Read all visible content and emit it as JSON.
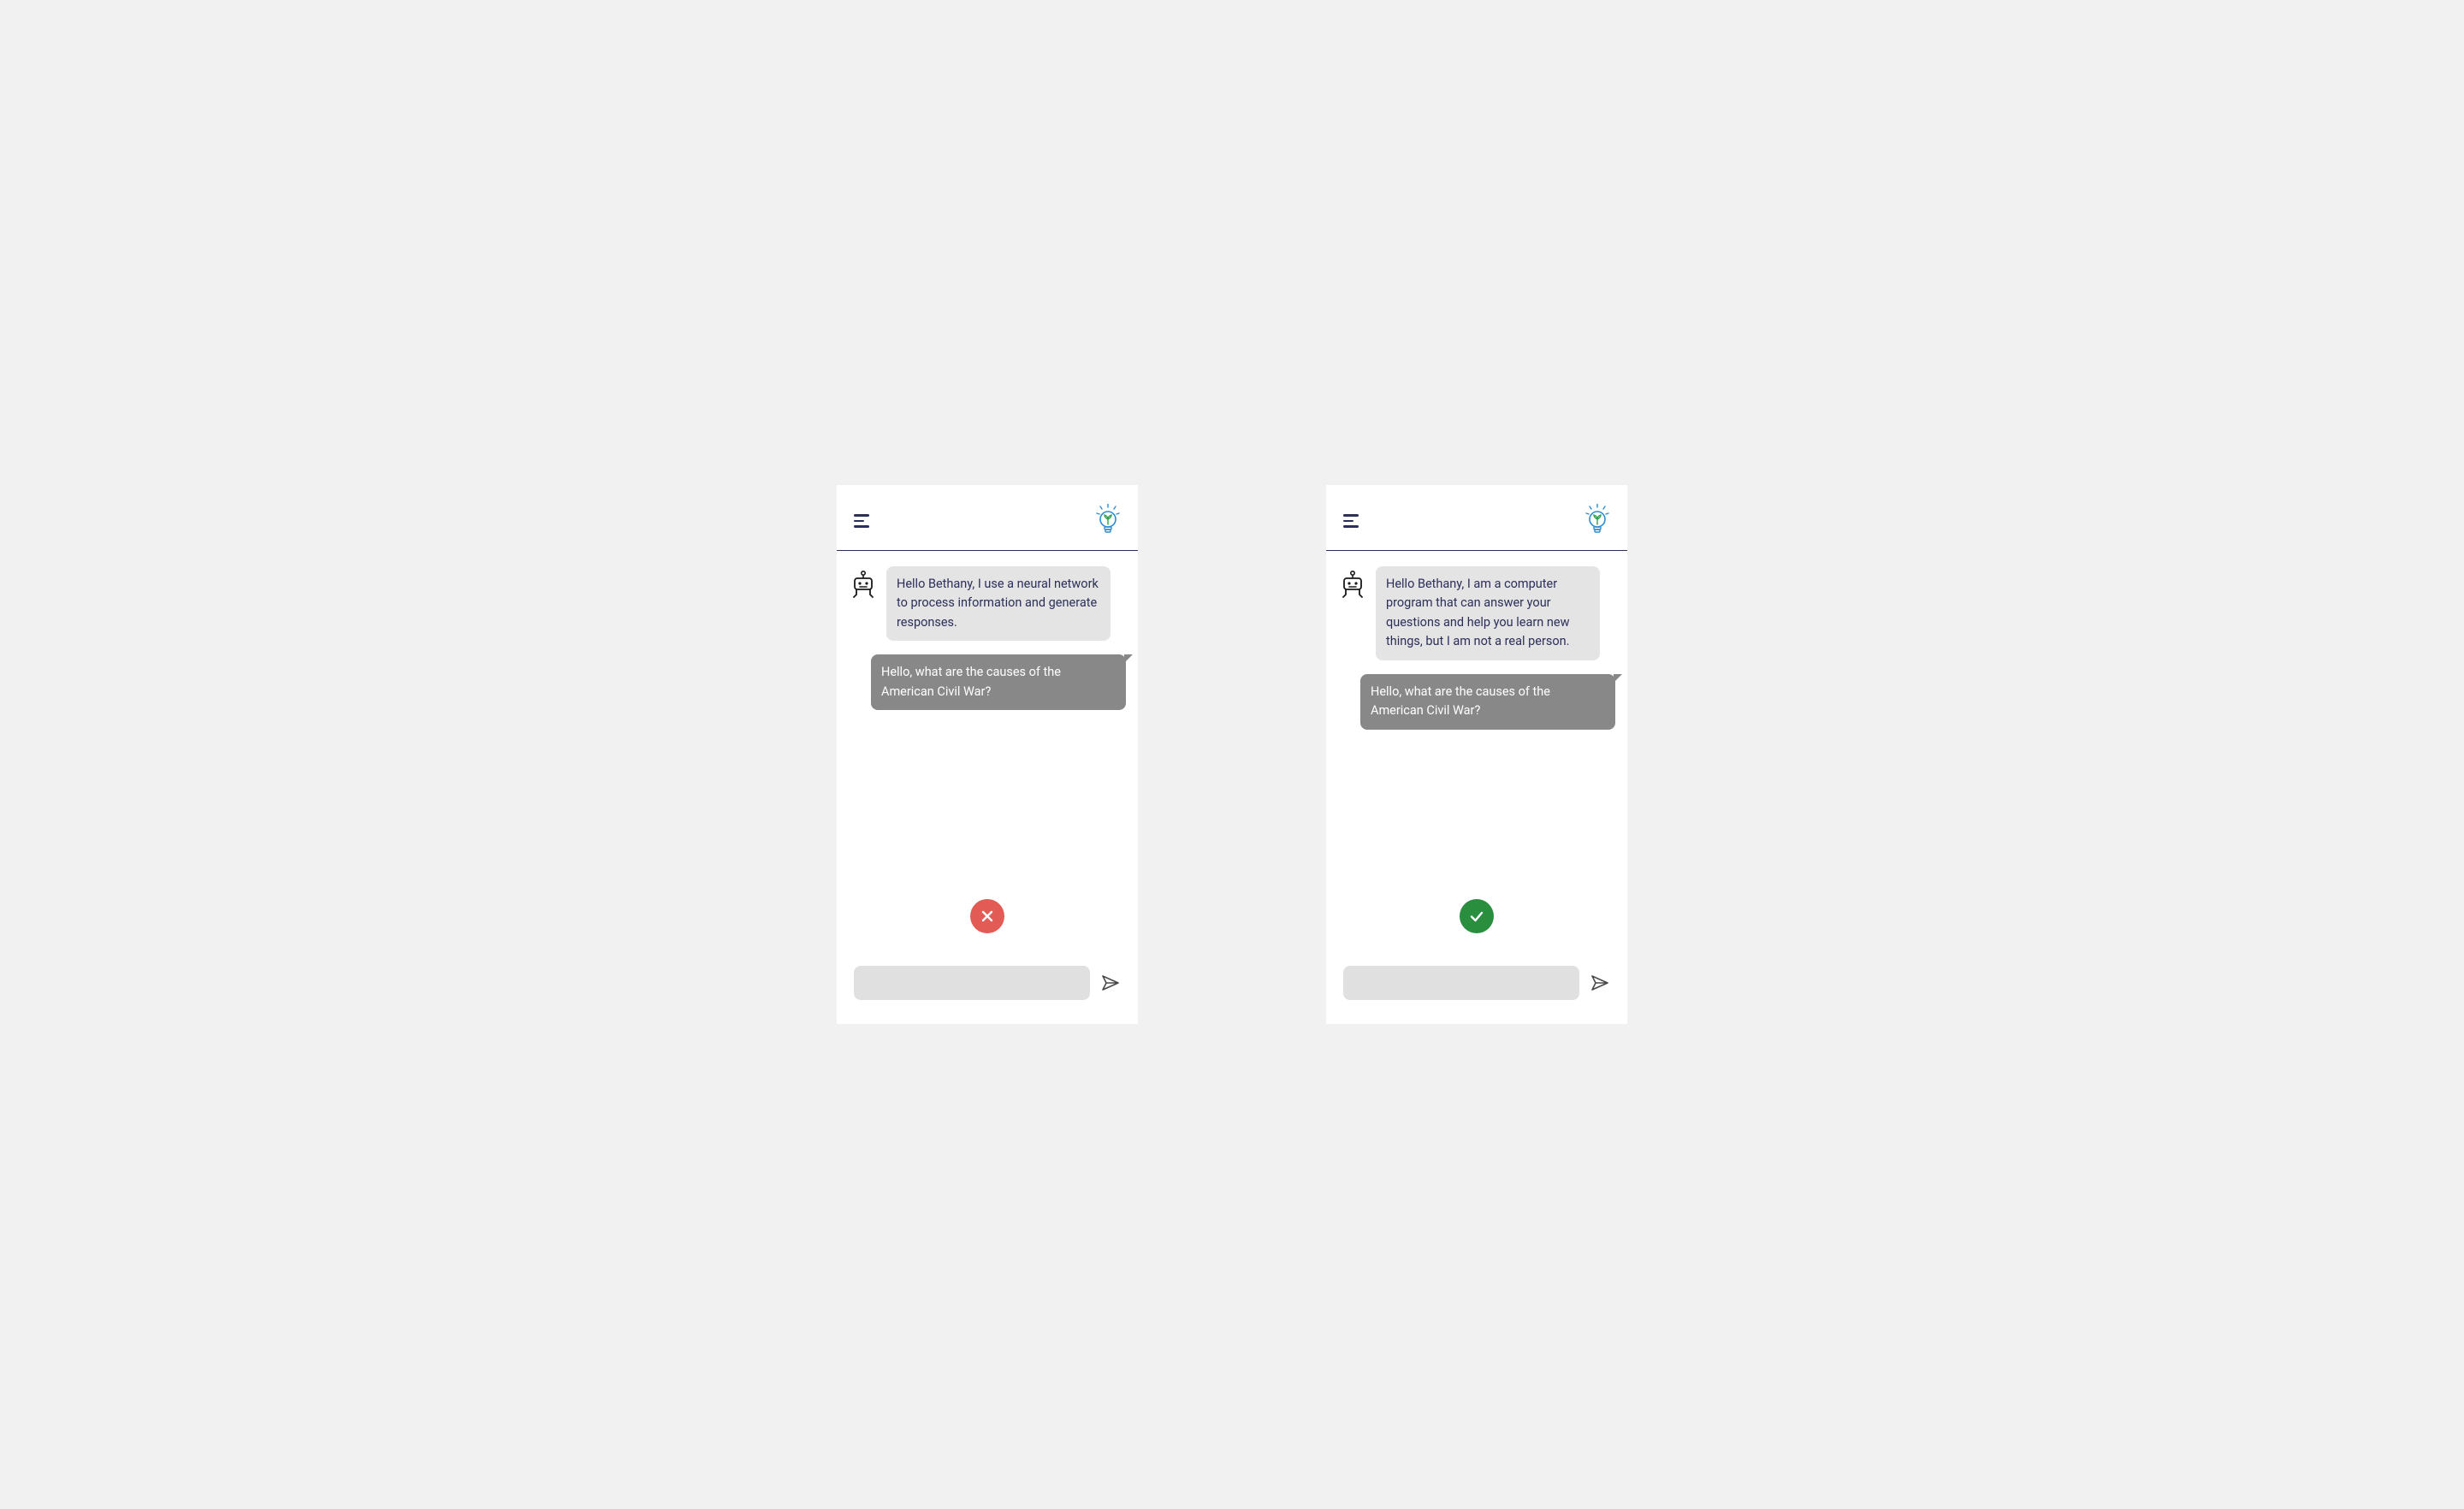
{
  "phones": [
    {
      "status": "bad",
      "bot_message": "Hello Bethany, I use a neural network to process information and generate responses.",
      "user_message": "Hello, what are the causes of the American Civil War?",
      "input_value": ""
    },
    {
      "status": "good",
      "bot_message": "Hello Bethany, I am a computer program that can answer your questions and help you learn new things, but I am not a real person.",
      "user_message": "Hello, what are the causes of the American Civil War?",
      "input_value": ""
    }
  ],
  "colors": {
    "accent_dark": "#2c2f5a",
    "bot_bubble": "#e4e4e4",
    "user_bubble": "#888888",
    "bad": "#e25b54",
    "good": "#2a8e3f",
    "bulb_blue": "#2c8cd6"
  },
  "icons": {
    "menu": "menu-icon",
    "logo": "lightbulb-plant-icon",
    "bot": "robot-avatar-icon",
    "bad": "cross-icon",
    "good": "check-icon",
    "send": "send-icon"
  }
}
